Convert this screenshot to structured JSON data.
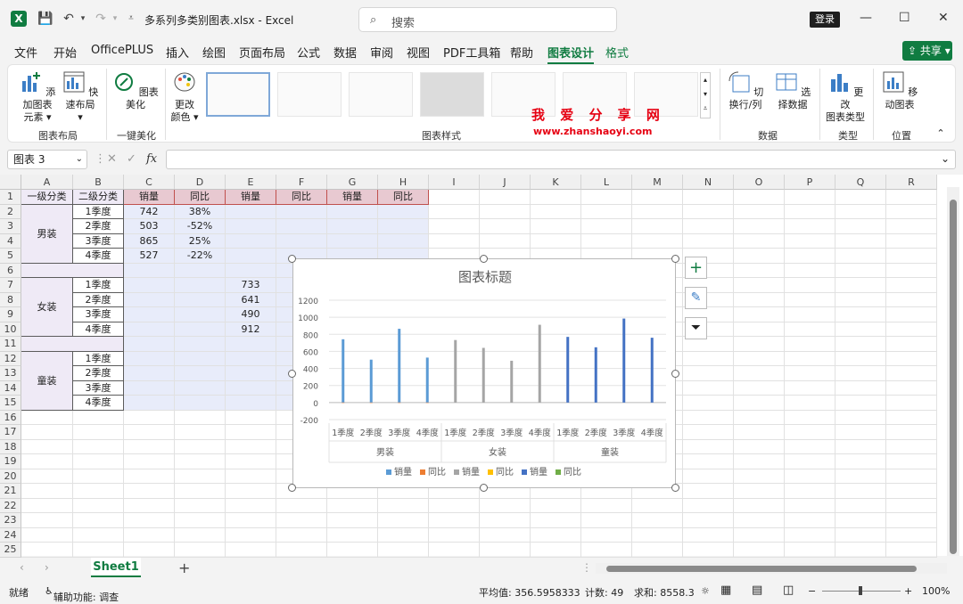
{
  "window": {
    "file_name": "多系列多类别图表.xlsx",
    "app_name": "Excel",
    "search_placeholder": "搜索",
    "login_label": "登录"
  },
  "menu": {
    "items": [
      "文件",
      "开始",
      "OfficePLUS",
      "插入",
      "绘图",
      "页面布局",
      "公式",
      "数据",
      "审阅",
      "视图",
      "PDF工具箱",
      "帮助",
      "图表设计",
      "格式"
    ],
    "active": "图表设计",
    "share_label": "共享"
  },
  "ribbon": {
    "add_element": "添加图表\n元素",
    "quick_layout": "快速布局",
    "beautify": "图表美化",
    "change_color": "更改\n颜色",
    "switch_rowcol": "切换行/列",
    "select_data": "选择数据",
    "change_type": "更改\n图表类型",
    "move_chart": "移动图表",
    "groups": {
      "layout": "图表布局",
      "oneclick": "一键美化",
      "styles": "图表样式",
      "data": "数据",
      "type": "类型",
      "location": "位置"
    },
    "watermark_cn": "我 爱 分 享 网",
    "watermark_url": "www.zhanshaoyi.com"
  },
  "formula_bar": {
    "name_box": "图表 3",
    "fx": "fx",
    "value": ""
  },
  "sheet": {
    "columns": [
      "A",
      "B",
      "C",
      "D",
      "E",
      "F",
      "G",
      "H",
      "I",
      "J",
      "K",
      "L",
      "M",
      "N",
      "O",
      "P",
      "Q",
      "R"
    ],
    "rows": [
      "1",
      "2",
      "3",
      "4",
      "5",
      "6",
      "7",
      "8",
      "9",
      "10",
      "11",
      "12",
      "13",
      "14",
      "15",
      "16",
      "17",
      "18",
      "19",
      "20",
      "21",
      "22",
      "23",
      "24",
      "25"
    ],
    "header": [
      "一级分类",
      "二级分类",
      "销量",
      "同比",
      "销量",
      "同比",
      "销量",
      "同比"
    ],
    "groups": [
      {
        "name": "男装",
        "quarters": [
          "1季度",
          "2季度",
          "3季度",
          "4季度"
        ],
        "sales": [
          "742",
          "503",
          "865",
          "527"
        ],
        "yoy": [
          "38%",
          "-52%",
          "25%",
          "-22%"
        ]
      },
      {
        "name": "女装",
        "quarters": [
          "1季度",
          "2季度",
          "3季度",
          "4季度"
        ],
        "sales": [
          "733",
          "641",
          "490",
          "912"
        ]
      },
      {
        "name": "童装",
        "quarters": [
          "1季度",
          "2季度",
          "3季度",
          "4季度"
        ]
      }
    ]
  },
  "chart_data": {
    "type": "bar",
    "title": "图表标题",
    "y_ticks": [
      "1200",
      "1000",
      "800",
      "600",
      "400",
      "200",
      "0",
      "-200"
    ],
    "ylim": [
      -200,
      1200
    ],
    "categories": [
      "1季度",
      "2季度",
      "3季度",
      "4季度",
      "1季度",
      "2季度",
      "3季度",
      "4季度",
      "1季度",
      "2季度",
      "3季度",
      "4季度"
    ],
    "groups": [
      "男装",
      "女装",
      "童装"
    ],
    "series": [
      {
        "name": "销量",
        "color": "#5b9bd5",
        "values": [
          742,
          503,
          865,
          527,
          null,
          null,
          null,
          null,
          null,
          null,
          null,
          null
        ]
      },
      {
        "name": "同比",
        "color": "#ed7d31",
        "values": [
          0.38,
          -0.52,
          0.25,
          -0.22,
          null,
          null,
          null,
          null,
          null,
          null,
          null,
          null
        ]
      },
      {
        "name": "销量",
        "color": "#a5a5a5",
        "values": [
          null,
          null,
          null,
          null,
          733,
          641,
          490,
          912,
          null,
          null,
          null,
          null
        ]
      },
      {
        "name": "同比",
        "color": "#ffc000",
        "values": [
          null,
          null,
          null,
          null,
          null,
          null,
          null,
          null,
          null,
          null,
          null,
          null
        ]
      },
      {
        "name": "销量",
        "color": "#4472c4",
        "values": [
          null,
          null,
          null,
          null,
          null,
          null,
          null,
          null,
          770,
          648,
          985,
          760
        ]
      },
      {
        "name": "同比",
        "color": "#70ad47",
        "values": [
          null,
          null,
          null,
          null,
          null,
          null,
          null,
          null,
          null,
          null,
          null,
          null
        ]
      }
    ],
    "legend_position": "bottom"
  },
  "tabs": {
    "sheet1": "Sheet1",
    "add": "+"
  },
  "status": {
    "ready": "就绪",
    "accessibility": "辅助功能: 调查",
    "average": "平均值: 356.5958333",
    "count": "计数: 49",
    "sum": "求和: 8558.3",
    "zoom": "100%"
  }
}
